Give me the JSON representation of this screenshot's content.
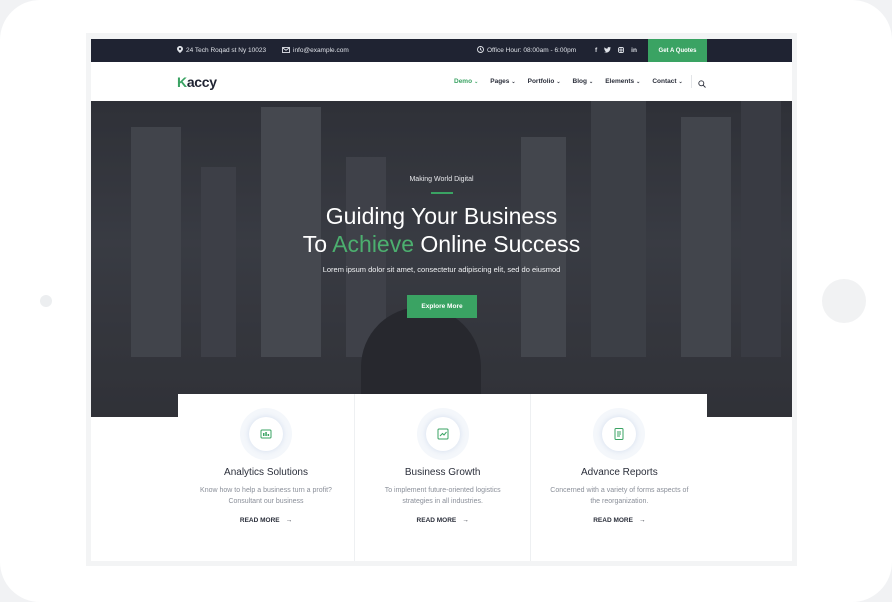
{
  "topbar": {
    "address": "24 Tech Roqad st Ny 10023",
    "email": "info@example.com",
    "hours": "Office Hour: 08:00am - 6:00pm",
    "social": [
      "f",
      "t",
      "ig",
      "in"
    ],
    "quote_button": "Get A Quotes"
  },
  "navbar": {
    "logo_letter": "K",
    "logo_rest": "accy",
    "items": [
      {
        "label": "Demo",
        "active": true
      },
      {
        "label": "Pages"
      },
      {
        "label": "Portfolio"
      },
      {
        "label": "Blog"
      },
      {
        "label": "Elements"
      },
      {
        "label": "Contact"
      }
    ]
  },
  "hero": {
    "kicker": "Making World Digital",
    "title_line1": "Guiding Your Business",
    "title_line2_pre": "To ",
    "title_line2_accent": "Achieve",
    "title_line2_post": " Online Success",
    "subtitle": "Lorem ipsum dolor sit amet, consectetur adipiscing elit, sed do eiusmod",
    "button": "Explore More"
  },
  "features": [
    {
      "title": "Analytics Solutions",
      "desc": "Know how to help a business turn a profit? Consultant our business",
      "link": "READ MORE",
      "icon": "analytics-icon"
    },
    {
      "title": "Business Growth",
      "desc": "To implement future-oriented logistics strategies in all industries.",
      "link": "READ MORE",
      "icon": "growth-icon"
    },
    {
      "title": "Advance Reports",
      "desc": "Concerned with a variety of forms aspects of the reorganization.",
      "link": "READ MORE",
      "icon": "reports-icon"
    }
  ],
  "colors": {
    "accent": "#3aa363",
    "topbar": "#1f2332"
  }
}
